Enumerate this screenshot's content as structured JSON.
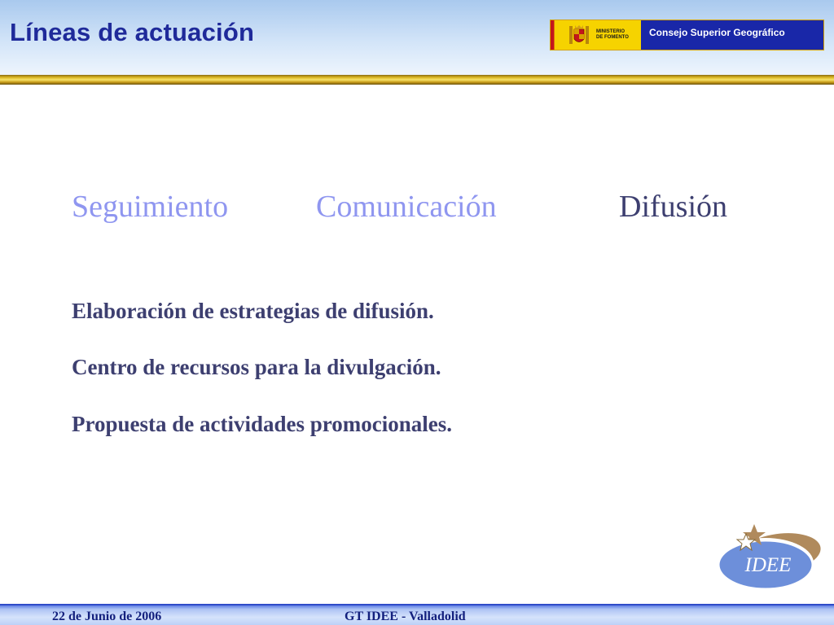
{
  "slide": {
    "title": "Líneas de actuación",
    "logo": {
      "ministry_text": "MINISTERIO\nDE FOMENTO",
      "organization": "Consejo Superior Geográfico"
    },
    "categories": [
      {
        "label": "Seguimiento",
        "state": "inactive"
      },
      {
        "label": "Comunicación",
        "state": "inactive"
      },
      {
        "label": "Difusión",
        "state": "active"
      }
    ],
    "lines": [
      "Elaboración de estrategias de difusión.",
      "Centro de recursos para la divulgación.",
      "Propuesta de actividades promocionales."
    ],
    "idee_logo_text": "IDEE",
    "footer": {
      "date": "22 de Junio de 2006",
      "event": "GT IDEE - Valladolid"
    }
  },
  "colors": {
    "title": "#1f2a9a",
    "category_inactive": "#8f96f0",
    "category_active": "#3d3f70",
    "body_text": "#3d3f70",
    "organization_box": "#1927a8",
    "footer_text": "#13207e"
  }
}
